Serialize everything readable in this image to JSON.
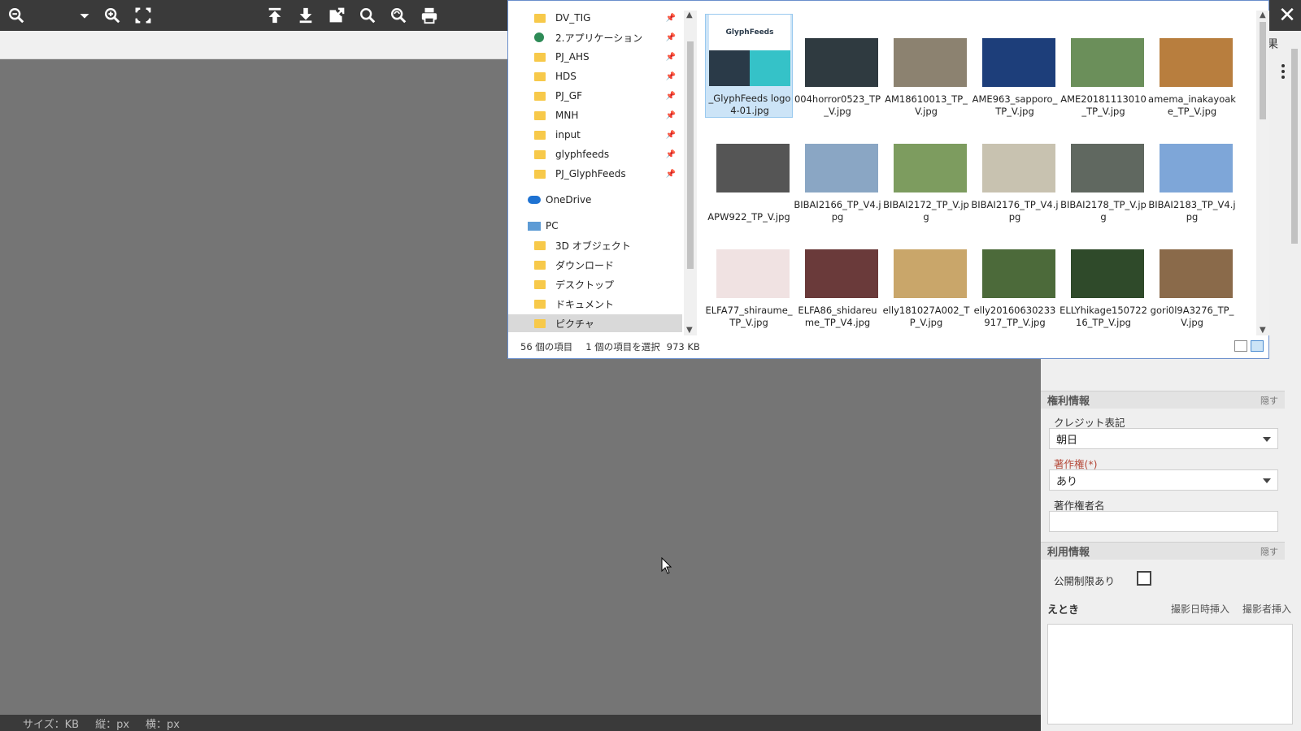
{
  "toolbar": {
    "icons": [
      "zoom-out-icon",
      "dropdown-caret-icon",
      "zoom-in-icon",
      "fit-screen-icon",
      "upload-icon",
      "download-icon",
      "open-external-icon",
      "search-icon",
      "search-refresh-icon",
      "print-icon"
    ]
  },
  "status": {
    "size": "サイズ：KB",
    "height": "縦：px",
    "width": "横：px"
  },
  "explorer": {
    "nav": [
      {
        "label": "DV_TIG",
        "pinned": true
      },
      {
        "label": "2.アプリケーション",
        "pinned": true
      },
      {
        "label": "PJ_AHS",
        "pinned": true
      },
      {
        "label": "HDS",
        "pinned": true
      },
      {
        "label": "PJ_GF",
        "pinned": true
      },
      {
        "label": "MNH",
        "pinned": true
      },
      {
        "label": "input",
        "pinned": true
      },
      {
        "label": "glyphfeeds",
        "pinned": true
      },
      {
        "label": "PJ_GlyphFeeds",
        "pinned": true
      },
      {
        "label": "OneDrive",
        "pinned": false
      },
      {
        "label": "PC",
        "pinned": false
      },
      {
        "label": "3D オブジェクト",
        "pinned": false
      },
      {
        "label": "ダウンロード",
        "pinned": false
      },
      {
        "label": "デスクトップ",
        "pinned": false
      },
      {
        "label": "ドキュメント",
        "pinned": false
      },
      {
        "label": "ピクチャ",
        "pinned": false
      }
    ],
    "files": [
      {
        "name": "_GlyphFeeds logo 4-01.jpg",
        "color": "#35c2c8",
        "selected": true
      },
      {
        "name": "004horror0523_TP_V.jpg",
        "color": "#2f3a40"
      },
      {
        "name": "AM18610013_TP_V.jpg",
        "color": "#8c8270"
      },
      {
        "name": "AME963_sapporo_TP_V.jpg",
        "color": "#1d3e7a"
      },
      {
        "name": "AME20181113010_TP_V.jpg",
        "color": "#6b8f5a"
      },
      {
        "name": "amema_inakayoake_TP_V.jpg",
        "color": "#b87e3e"
      },
      {
        "name": "APW922_TP_V.jpg",
        "color": "#555555"
      },
      {
        "name": "BIBAI2166_TP_V4.jpg",
        "color": "#8aa6c4"
      },
      {
        "name": "BIBAI2172_TP_V.jpg",
        "color": "#7d9c5f"
      },
      {
        "name": "BIBAI2176_TP_V4.jpg",
        "color": "#c8c2b0"
      },
      {
        "name": "BIBAI2178_TP_V.jpg",
        "color": "#606860"
      },
      {
        "name": "BIBAI2183_TP_V4.jpg",
        "color": "#7ea6d8"
      },
      {
        "name": "ELFA77_shiraume_TP_V.jpg",
        "color": "#f0e2e2"
      },
      {
        "name": "ELFA86_shidareume_TP_V4.jpg",
        "color": "#6a3a3a"
      },
      {
        "name": "elly181027A002_TP_V.jpg",
        "color": "#c9a66a"
      },
      {
        "name": "elly20160630233917_TP_V.jpg",
        "color": "#4c6a3a"
      },
      {
        "name": "ELLYhikage15072216_TP_V.jpg",
        "color": "#2f4a2a"
      },
      {
        "name": "gori0l9A3276_TP_V.jpg",
        "color": "#8a6a4a"
      }
    ],
    "item_count": "56 個の項目",
    "selection": "1 個の項目を選択",
    "selection_size": "973 KB"
  },
  "panel": {
    "top_label": "果",
    "hide_label": "隠す",
    "rights_section": "権利情報",
    "credit_label": "クレジット表記",
    "credit_value": "朝日",
    "copyright_label": "著作権(*)",
    "copyright_value": "あり",
    "copyright_holder_label": "著作権者名",
    "usage_section": "利用情報",
    "restricted_label": "公開制限あり",
    "etoki_label": "えとき",
    "insert_date": "撮影日時挿入",
    "insert_photographer": "撮影者挿入"
  },
  "colors": {
    "toolbar_bg": "#3a3a3a",
    "canvas_bg": "#757575",
    "panel_bg": "#efefef",
    "selection": "#cce4f7"
  }
}
